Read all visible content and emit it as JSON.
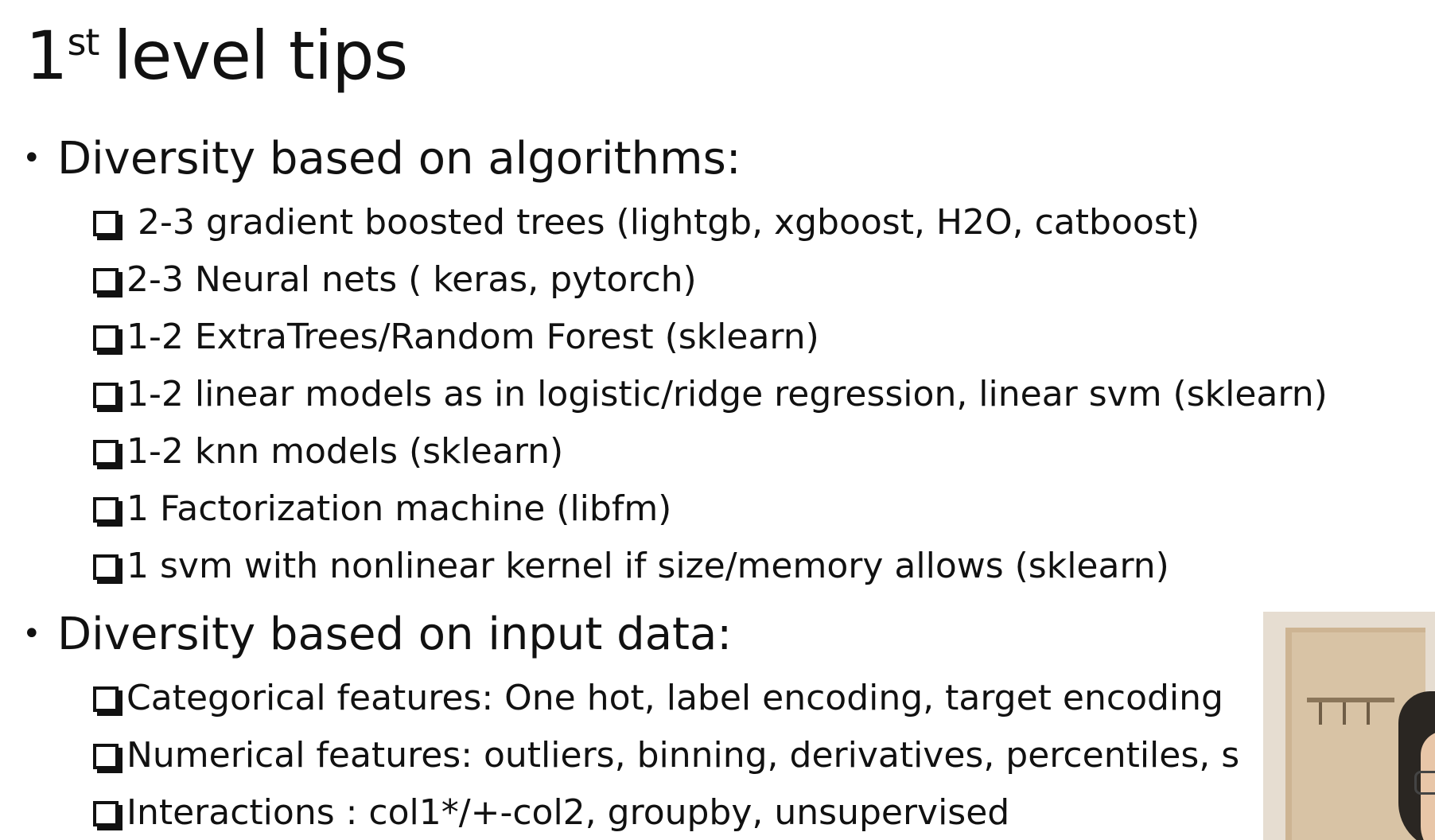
{
  "slide": {
    "title_main": "1",
    "title_sup": "st",
    "title_rest": "level tips",
    "sections": [
      {
        "heading": "Diversity based on algorithms:",
        "items": [
          " 2-3 gradient boosted trees (lightgb, xgboost, H2O, catboost)",
          "2-3 Neural nets ( keras, pytorch)",
          "1-2 ExtraTrees/Random Forest (sklearn)",
          "1-2 linear models as in logistic/ridge regression, linear svm  (sklearn)",
          "1-2 knn models (sklearn)",
          "1 Factorization machine (libfm)",
          "1 svm with nonlinear kernel if size/memory allows (sklearn)"
        ]
      },
      {
        "heading": "Diversity based on input data:",
        "items": [
          "Categorical features: One hot, label encoding, target encoding",
          "Numerical features: outliers, binning, derivatives, percentiles, s",
          "Interactions : col1*/+-col2, groupby, unsupervised"
        ]
      }
    ]
  },
  "icons": {
    "bullet": "bullet-dot-icon",
    "checkbox": "checkbox-square-icon"
  }
}
